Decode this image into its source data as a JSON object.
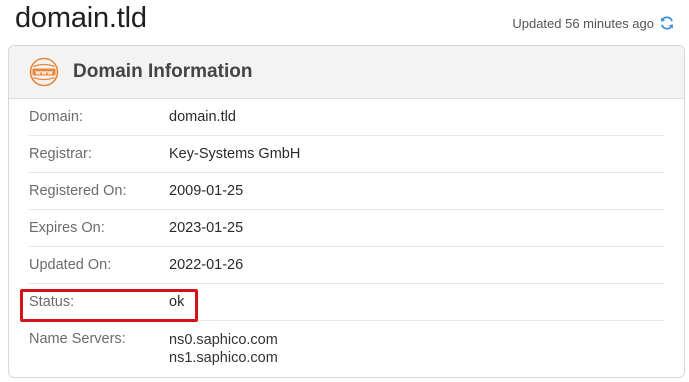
{
  "page": {
    "title": "domain.tld",
    "updated_text": "Updated 56 minutes ago"
  },
  "card": {
    "title": "Domain Information",
    "icon": "www-icon"
  },
  "rows": [
    {
      "label": "Domain:",
      "value": "domain.tld"
    },
    {
      "label": "Registrar:",
      "value": "Key-Systems GmbH"
    },
    {
      "label": "Registered On:",
      "value": "2009-01-25"
    },
    {
      "label": "Expires On:",
      "value": "2023-01-25"
    },
    {
      "label": "Updated On:",
      "value": "2022-01-26"
    },
    {
      "label": "Status:",
      "value": "ok"
    }
  ],
  "name_servers": {
    "label": "Name Servers:",
    "values": [
      "ns0.saphico.com",
      "ns1.saphico.com"
    ]
  },
  "colors": {
    "accent_orange": "#e8873a",
    "refresh_blue": "#3b8fd6",
    "highlight_red": "#d2141a"
  }
}
